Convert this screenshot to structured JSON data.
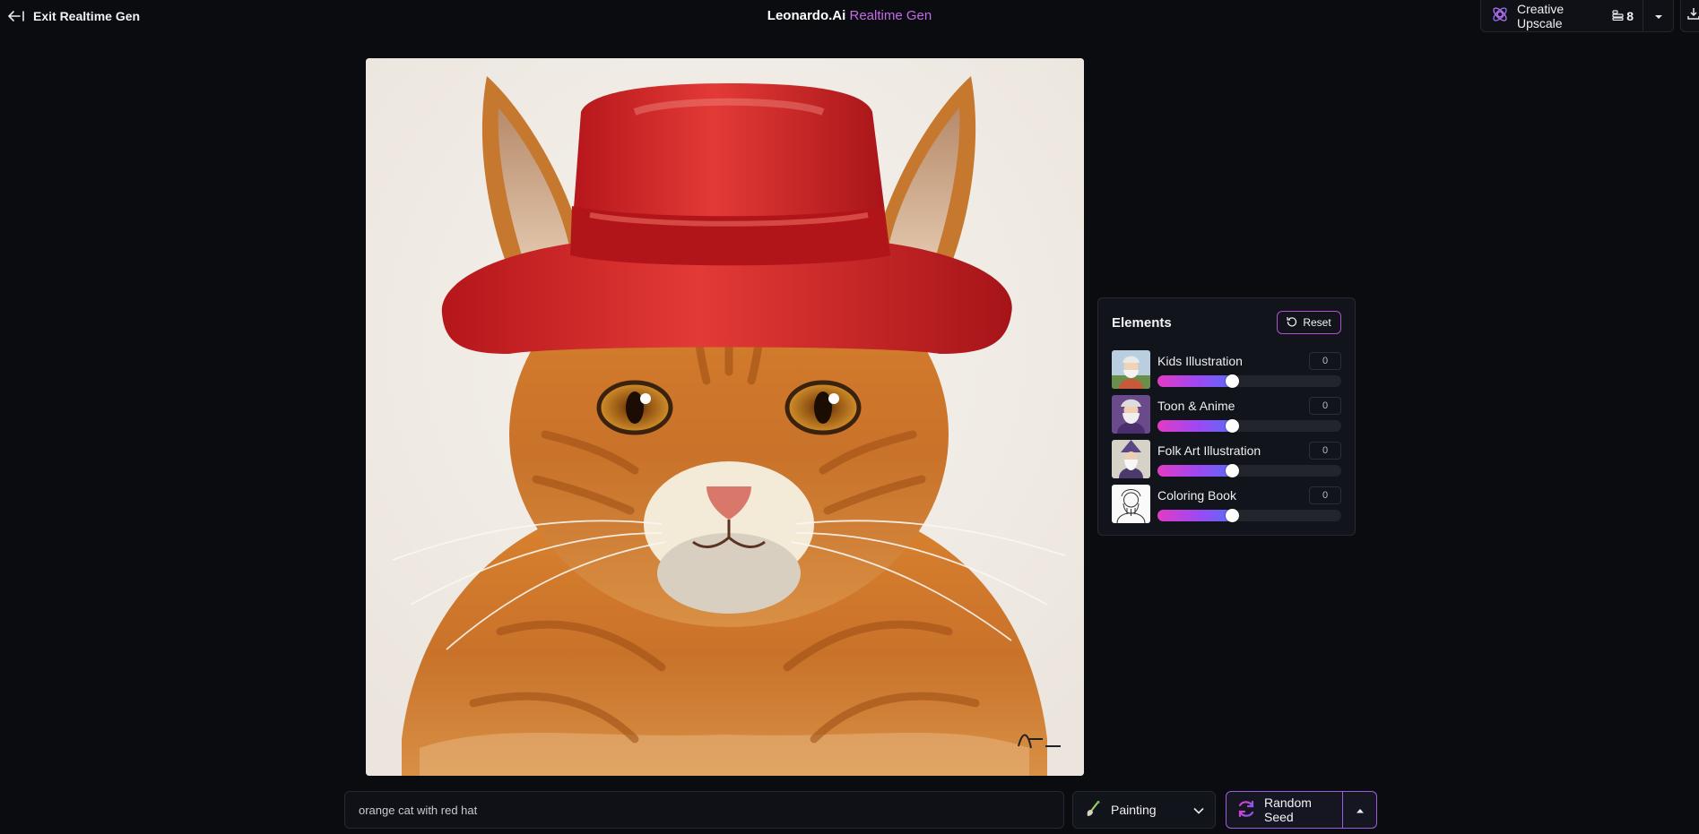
{
  "header": {
    "exit_label": "Exit Realtime Gen",
    "brand": "Leonardo.Ai",
    "mode": "Realtime Gen",
    "upscale_label": "Creative Upscale",
    "upscale_cost": "8"
  },
  "canvas": {
    "subject": "orange cat wearing a red hat"
  },
  "elements": {
    "title": "Elements",
    "reset_label": "Reset",
    "items": [
      {
        "name": "Kids Illustration",
        "value": "0",
        "level": 0.41
      },
      {
        "name": "Toon & Anime",
        "value": "0",
        "level": 0.41
      },
      {
        "name": "Folk Art Illustration",
        "value": "0",
        "level": 0.41
      },
      {
        "name": "Coloring Book",
        "value": "0",
        "level": 0.41
      }
    ]
  },
  "bottom": {
    "prompt_value": "orange cat with red hat",
    "style_label": "Painting",
    "seed_label": "Random Seed"
  },
  "colors": {
    "accent": "#c46be8",
    "background": "#0b0c10",
    "slider_start": "#e33bc4",
    "slider_end": "#5b6cf6"
  },
  "icons": [
    "arrow-left-bar-icon",
    "upscale-orbit-icon",
    "coins-icon",
    "chevron-down-icon",
    "download-icon",
    "reset-icon",
    "paintbrush-icon",
    "refresh-icon",
    "caret-up-icon"
  ]
}
